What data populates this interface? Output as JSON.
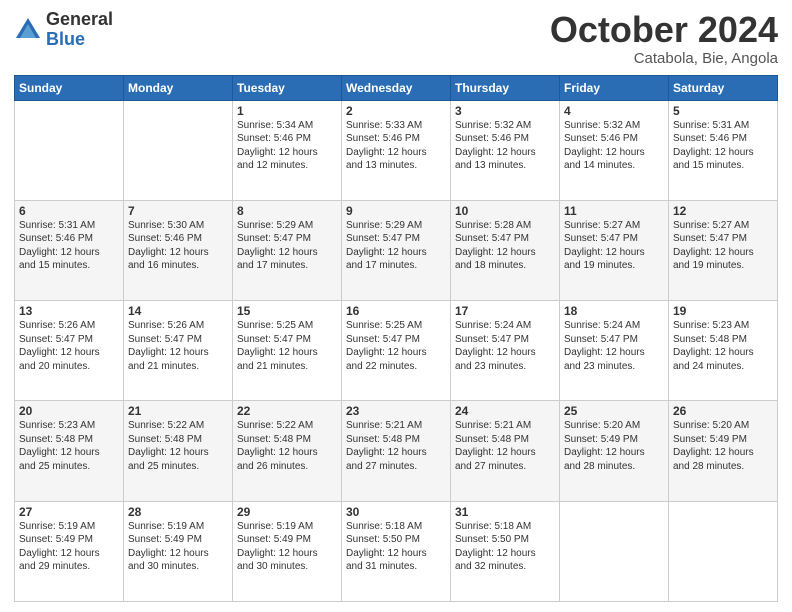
{
  "logo": {
    "general": "General",
    "blue": "Blue"
  },
  "header": {
    "month": "October 2024",
    "location": "Catabola, Bie, Angola"
  },
  "days_of_week": [
    "Sunday",
    "Monday",
    "Tuesday",
    "Wednesday",
    "Thursday",
    "Friday",
    "Saturday"
  ],
  "weeks": [
    [
      null,
      null,
      {
        "day": 1,
        "sunrise": "5:34 AM",
        "sunset": "5:46 PM",
        "daylight": "12 hours and 12 minutes."
      },
      {
        "day": 2,
        "sunrise": "5:33 AM",
        "sunset": "5:46 PM",
        "daylight": "12 hours and 13 minutes."
      },
      {
        "day": 3,
        "sunrise": "5:32 AM",
        "sunset": "5:46 PM",
        "daylight": "12 hours and 13 minutes."
      },
      {
        "day": 4,
        "sunrise": "5:32 AM",
        "sunset": "5:46 PM",
        "daylight": "12 hours and 14 minutes."
      },
      {
        "day": 5,
        "sunrise": "5:31 AM",
        "sunset": "5:46 PM",
        "daylight": "12 hours and 15 minutes."
      }
    ],
    [
      {
        "day": 6,
        "sunrise": "5:31 AM",
        "sunset": "5:46 PM",
        "daylight": "12 hours and 15 minutes."
      },
      {
        "day": 7,
        "sunrise": "5:30 AM",
        "sunset": "5:46 PM",
        "daylight": "12 hours and 16 minutes."
      },
      {
        "day": 8,
        "sunrise": "5:29 AM",
        "sunset": "5:47 PM",
        "daylight": "12 hours and 17 minutes."
      },
      {
        "day": 9,
        "sunrise": "5:29 AM",
        "sunset": "5:47 PM",
        "daylight": "12 hours and 17 minutes."
      },
      {
        "day": 10,
        "sunrise": "5:28 AM",
        "sunset": "5:47 PM",
        "daylight": "12 hours and 18 minutes."
      },
      {
        "day": 11,
        "sunrise": "5:27 AM",
        "sunset": "5:47 PM",
        "daylight": "12 hours and 19 minutes."
      },
      {
        "day": 12,
        "sunrise": "5:27 AM",
        "sunset": "5:47 PM",
        "daylight": "12 hours and 19 minutes."
      }
    ],
    [
      {
        "day": 13,
        "sunrise": "5:26 AM",
        "sunset": "5:47 PM",
        "daylight": "12 hours and 20 minutes."
      },
      {
        "day": 14,
        "sunrise": "5:26 AM",
        "sunset": "5:47 PM",
        "daylight": "12 hours and 21 minutes."
      },
      {
        "day": 15,
        "sunrise": "5:25 AM",
        "sunset": "5:47 PM",
        "daylight": "12 hours and 21 minutes."
      },
      {
        "day": 16,
        "sunrise": "5:25 AM",
        "sunset": "5:47 PM",
        "daylight": "12 hours and 22 minutes."
      },
      {
        "day": 17,
        "sunrise": "5:24 AM",
        "sunset": "5:47 PM",
        "daylight": "12 hours and 23 minutes."
      },
      {
        "day": 18,
        "sunrise": "5:24 AM",
        "sunset": "5:47 PM",
        "daylight": "12 hours and 23 minutes."
      },
      {
        "day": 19,
        "sunrise": "5:23 AM",
        "sunset": "5:48 PM",
        "daylight": "12 hours and 24 minutes."
      }
    ],
    [
      {
        "day": 20,
        "sunrise": "5:23 AM",
        "sunset": "5:48 PM",
        "daylight": "12 hours and 25 minutes."
      },
      {
        "day": 21,
        "sunrise": "5:22 AM",
        "sunset": "5:48 PM",
        "daylight": "12 hours and 25 minutes."
      },
      {
        "day": 22,
        "sunrise": "5:22 AM",
        "sunset": "5:48 PM",
        "daylight": "12 hours and 26 minutes."
      },
      {
        "day": 23,
        "sunrise": "5:21 AM",
        "sunset": "5:48 PM",
        "daylight": "12 hours and 27 minutes."
      },
      {
        "day": 24,
        "sunrise": "5:21 AM",
        "sunset": "5:48 PM",
        "daylight": "12 hours and 27 minutes."
      },
      {
        "day": 25,
        "sunrise": "5:20 AM",
        "sunset": "5:49 PM",
        "daylight": "12 hours and 28 minutes."
      },
      {
        "day": 26,
        "sunrise": "5:20 AM",
        "sunset": "5:49 PM",
        "daylight": "12 hours and 28 minutes."
      }
    ],
    [
      {
        "day": 27,
        "sunrise": "5:19 AM",
        "sunset": "5:49 PM",
        "daylight": "12 hours and 29 minutes."
      },
      {
        "day": 28,
        "sunrise": "5:19 AM",
        "sunset": "5:49 PM",
        "daylight": "12 hours and 30 minutes."
      },
      {
        "day": 29,
        "sunrise": "5:19 AM",
        "sunset": "5:49 PM",
        "daylight": "12 hours and 30 minutes."
      },
      {
        "day": 30,
        "sunrise": "5:18 AM",
        "sunset": "5:50 PM",
        "daylight": "12 hours and 31 minutes."
      },
      {
        "day": 31,
        "sunrise": "5:18 AM",
        "sunset": "5:50 PM",
        "daylight": "12 hours and 32 minutes."
      },
      null,
      null
    ]
  ],
  "labels": {
    "sunrise": "Sunrise:",
    "sunset": "Sunset:",
    "daylight": "Daylight: 12 hours"
  }
}
